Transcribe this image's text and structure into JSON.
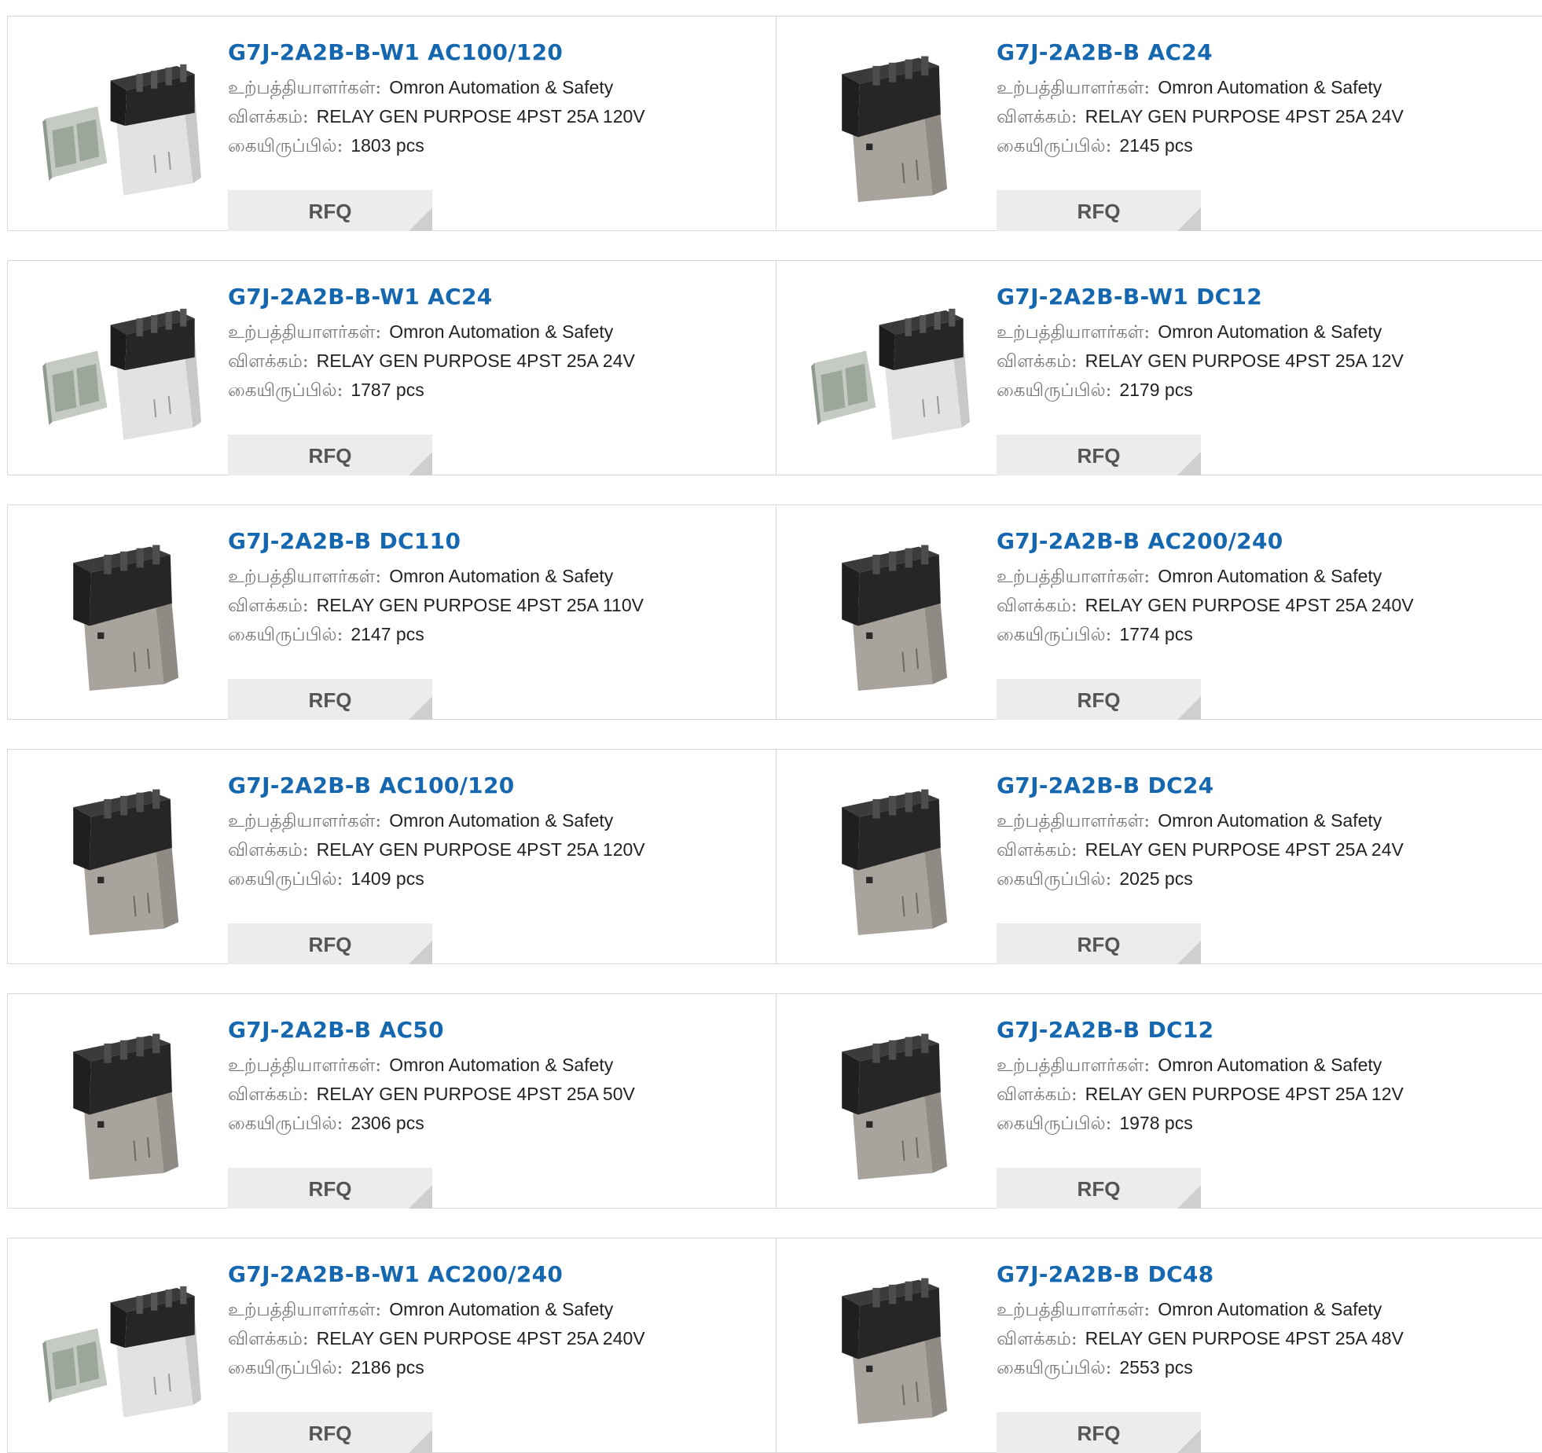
{
  "labels": {
    "manufacturer": "உற்பத்தியாளர்கள்:",
    "description": "விளக்கம்:",
    "stock": "கையிருப்பில்:",
    "rfq": "RFQ"
  },
  "products": [
    {
      "part": "G7J-2A2B-B-W1 AC100/120",
      "manufacturer": "Omron Automation & Safety",
      "description": "RELAY GEN PURPOSE 4PST 25A 120V",
      "stock": "1803 pcs",
      "image": "relay-with-bracket"
    },
    {
      "part": "G7J-2A2B-B AC24",
      "manufacturer": "Omron Automation & Safety",
      "description": "RELAY GEN PURPOSE 4PST 25A 24V",
      "stock": "2145 pcs",
      "image": "relay"
    },
    {
      "part": "G7J-2A2B-B-W1 AC24",
      "manufacturer": "Omron Automation & Safety",
      "description": "RELAY GEN PURPOSE 4PST 25A 24V",
      "stock": "1787 pcs",
      "image": "relay-with-bracket"
    },
    {
      "part": "G7J-2A2B-B-W1 DC12",
      "manufacturer": "Omron Automation & Safety",
      "description": "RELAY GEN PURPOSE 4PST 25A 12V",
      "stock": "2179 pcs",
      "image": "relay-with-bracket"
    },
    {
      "part": "G7J-2A2B-B DC110",
      "manufacturer": "Omron Automation & Safety",
      "description": "RELAY GEN PURPOSE 4PST 25A 110V",
      "stock": "2147 pcs",
      "image": "relay"
    },
    {
      "part": "G7J-2A2B-B AC200/240",
      "manufacturer": "Omron Automation & Safety",
      "description": "RELAY GEN PURPOSE 4PST 25A 240V",
      "stock": "1774 pcs",
      "image": "relay"
    },
    {
      "part": "G7J-2A2B-B AC100/120",
      "manufacturer": "Omron Automation & Safety",
      "description": "RELAY GEN PURPOSE 4PST 25A 120V",
      "stock": "1409 pcs",
      "image": "relay"
    },
    {
      "part": "G7J-2A2B-B DC24",
      "manufacturer": "Omron Automation & Safety",
      "description": "RELAY GEN PURPOSE 4PST 25A 24V",
      "stock": "2025 pcs",
      "image": "relay"
    },
    {
      "part": "G7J-2A2B-B AC50",
      "manufacturer": "Omron Automation & Safety",
      "description": "RELAY GEN PURPOSE 4PST 25A 50V",
      "stock": "2306 pcs",
      "image": "relay"
    },
    {
      "part": "G7J-2A2B-B DC12",
      "manufacturer": "Omron Automation & Safety",
      "description": "RELAY GEN PURPOSE 4PST 25A 12V",
      "stock": "1978 pcs",
      "image": "relay"
    },
    {
      "part": "G7J-2A2B-B-W1 AC200/240",
      "manufacturer": "Omron Automation & Safety",
      "description": "RELAY GEN PURPOSE 4PST 25A 240V",
      "stock": "2186 pcs",
      "image": "relay-with-bracket"
    },
    {
      "part": "G7J-2A2B-B DC48",
      "manufacturer": "Omron Automation & Safety",
      "description": "RELAY GEN PURPOSE 4PST 25A 48V",
      "stock": "2553 pcs",
      "image": "relay"
    }
  ],
  "colors": {
    "link": "#1567b0",
    "rfq_background": "#ececec",
    "border": "#d8d8d8"
  }
}
